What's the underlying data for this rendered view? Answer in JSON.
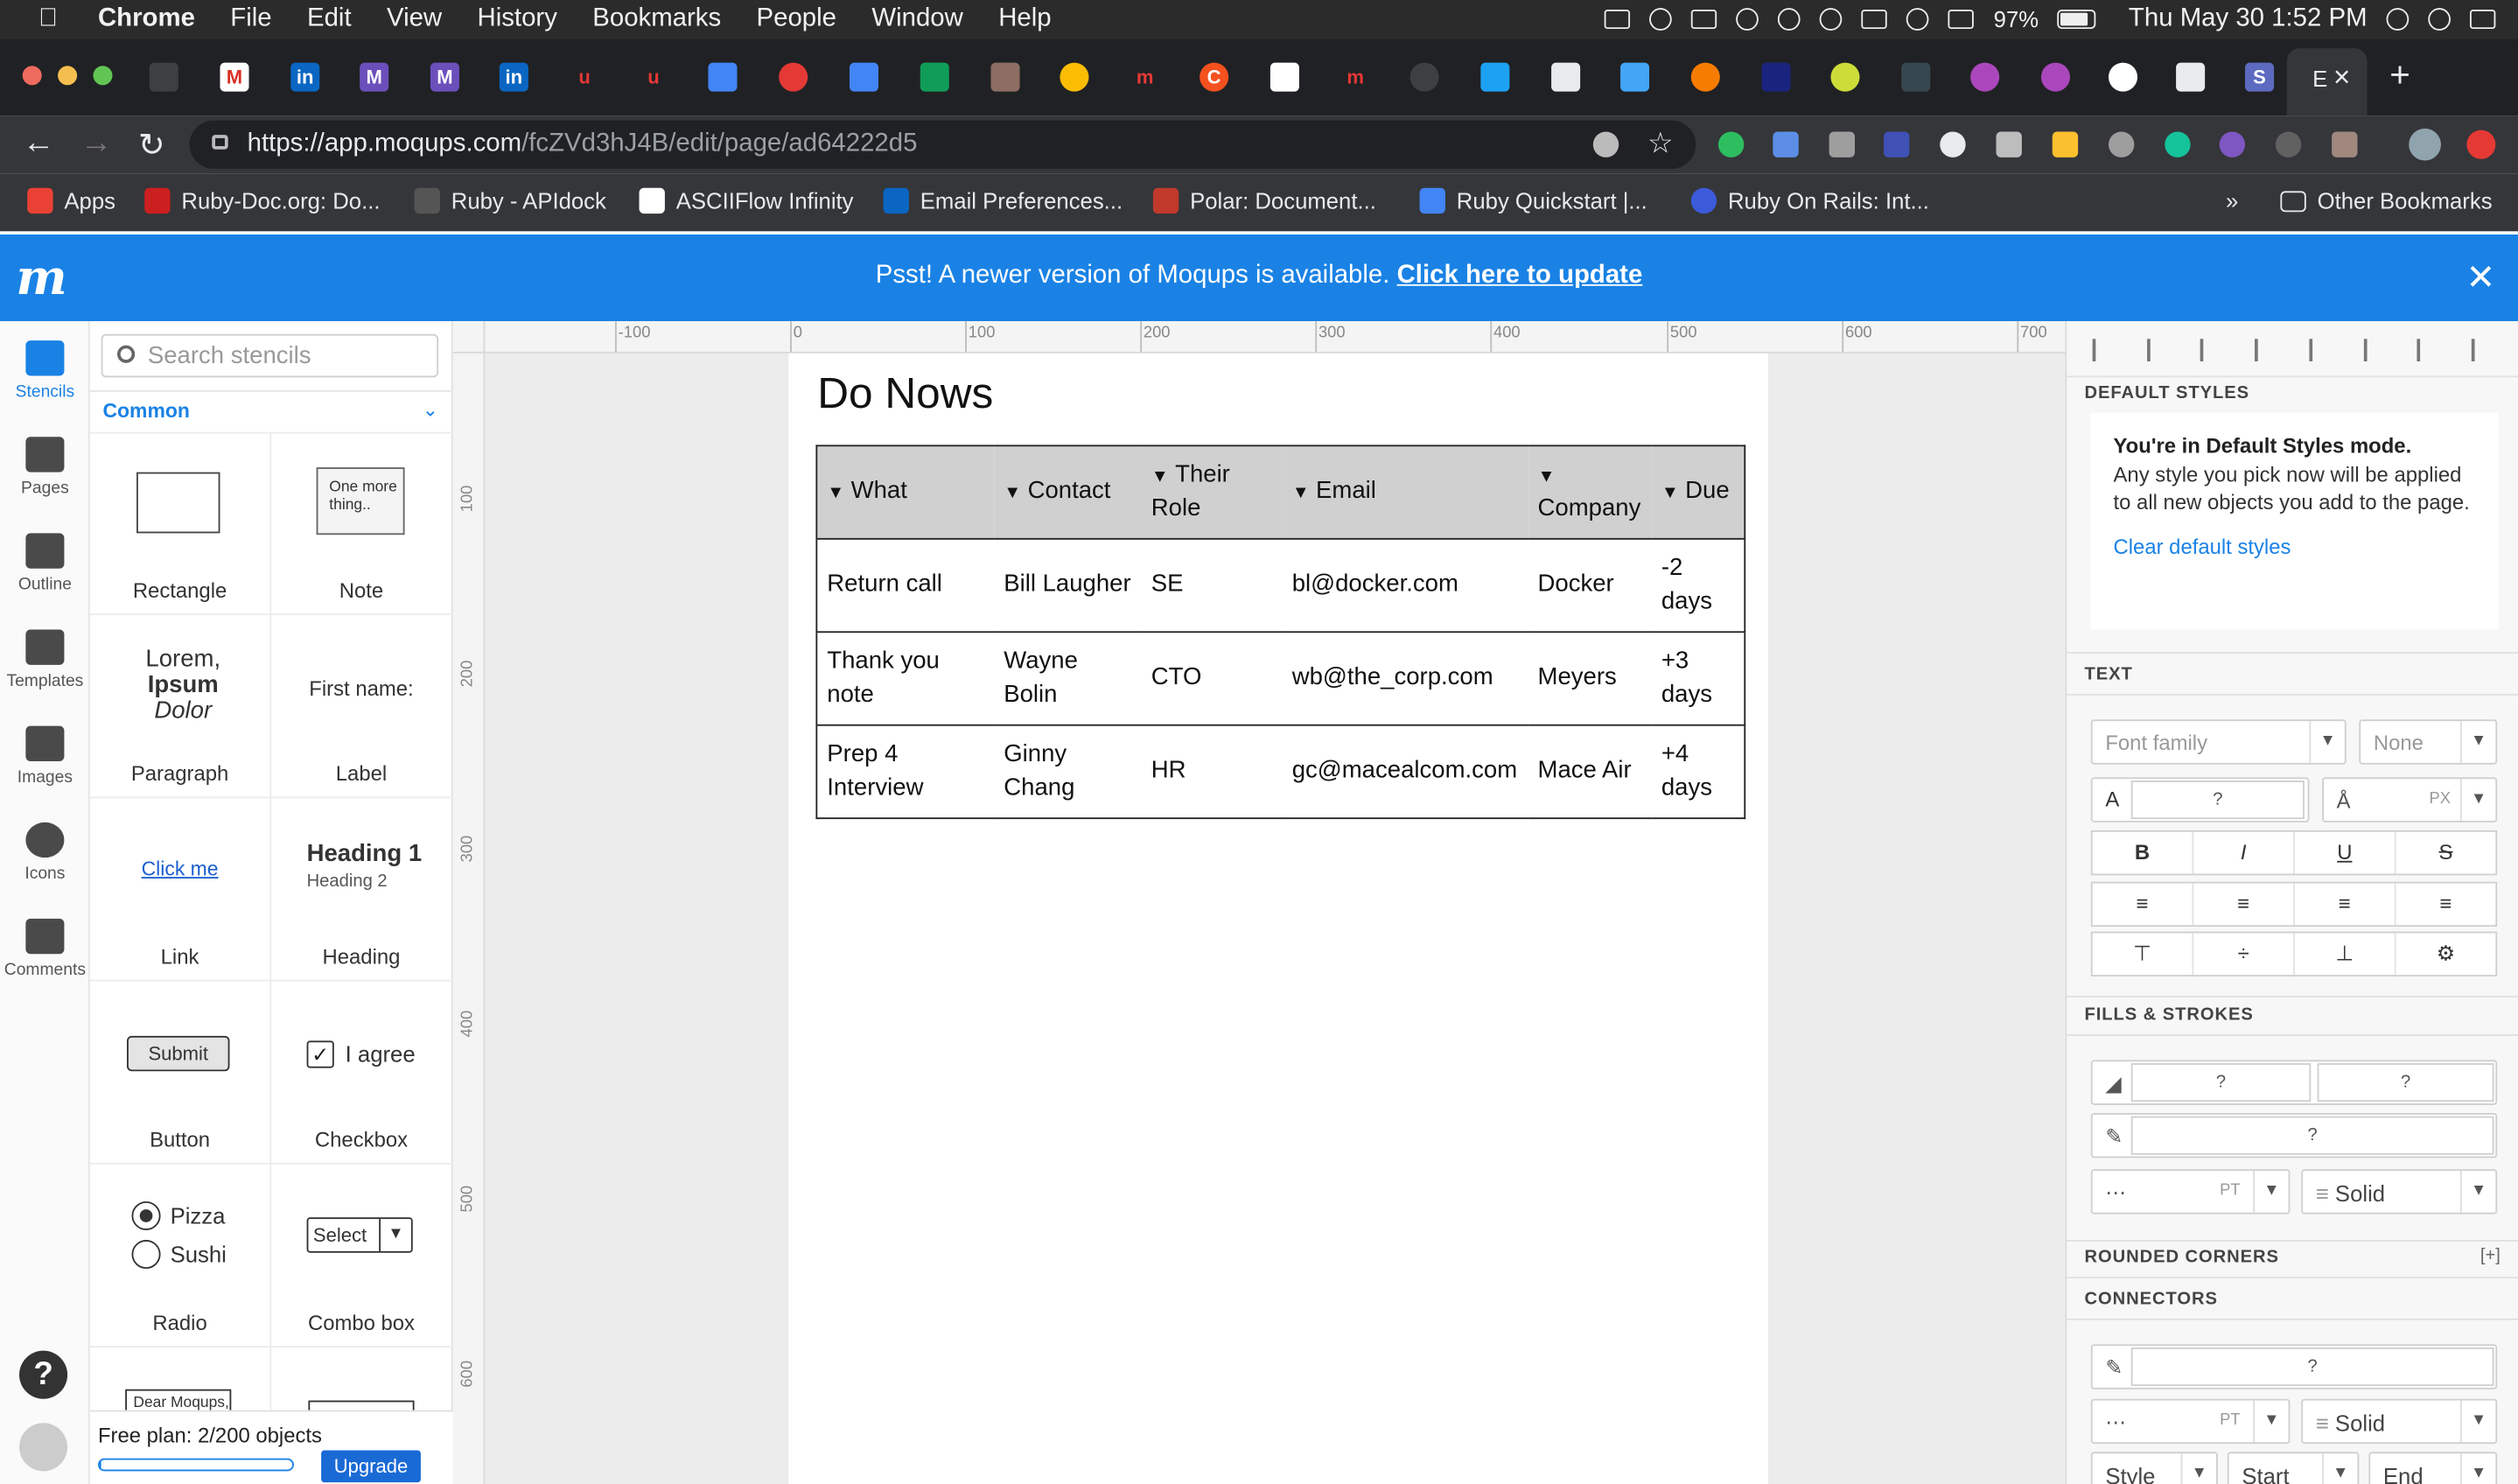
{
  "menubar": {
    "app_name": "Chrome",
    "menus": [
      "File",
      "Edit",
      "View",
      "History",
      "Bookmarks",
      "People",
      "Window",
      "Help"
    ],
    "battery": "97%",
    "clock": "Thu May 30  1:52 PM"
  },
  "browser": {
    "url_host": "https://app.moqups.com",
    "url_path": "/fcZVd3hJ4B/edit/page/ad64222d5",
    "active_tab_label": "E",
    "bookmarks": [
      {
        "label": "Apps",
        "color": "#e94235"
      },
      {
        "label": "Ruby-Doc.org: Do...",
        "color": "#cc1f1f"
      },
      {
        "label": "Ruby - APIdock",
        "color": "#555555"
      },
      {
        "label": "ASCIIFlow Infinity",
        "color": "#ffffff"
      },
      {
        "label": "Email Preferences...",
        "color": "#0a66c2"
      },
      {
        "label": "Polar: Document...",
        "color": "#c0392b"
      },
      {
        "label": "Ruby Quickstart  |...",
        "color": "#4285f4"
      },
      {
        "label": "Ruby On Rails: Int...",
        "color": "#3b5bdb"
      }
    ],
    "other_bookmarks": "Other Bookmarks"
  },
  "banner": {
    "logo": "m",
    "message": "Psst! A newer version of Moqups is available.",
    "link": "Click here to update"
  },
  "rail": {
    "items": [
      "Stencils",
      "Pages",
      "Outline",
      "Templates",
      "Images",
      "Icons",
      "Comments"
    ],
    "help": "?"
  },
  "stencils": {
    "search_placeholder": "Search stencils",
    "category": "Common",
    "items": [
      "Rectangle",
      "Note",
      "Paragraph",
      "Label",
      "Link",
      "Heading",
      "Button",
      "Checkbox",
      "Radio",
      "Combo box"
    ],
    "note_preview": "One more thing..",
    "paragraph_preview": [
      "Lorem,",
      "Ipsum",
      "Dolor"
    ],
    "label_preview": "First name:",
    "link_preview": "Click me",
    "heading_preview": [
      "Heading 1",
      "Heading 2"
    ],
    "button_preview": "Submit",
    "checkbox_preview": "I agree",
    "radio_preview": [
      "Pizza",
      "Sushi"
    ],
    "combo_preview": "Select",
    "letter_preview": "Dear Moqups,",
    "free_plan": "Free plan: 2/200 objects",
    "plan_usage_fraction": 0.01,
    "upgrade": "Upgrade"
  },
  "ruler": {
    "top": [
      "-100",
      "0",
      "100",
      "200",
      "300",
      "400",
      "500",
      "600",
      "700"
    ],
    "left": [
      "100",
      "200",
      "300",
      "400",
      "500",
      "600"
    ]
  },
  "canvas": {
    "title": "Do Nows",
    "columns": [
      "What",
      "Contact",
      "Their Role",
      "Email",
      "Company",
      "Due"
    ],
    "rows": [
      [
        "Return call",
        "Bill Laugher",
        "SE",
        "bl@docker.com",
        "Docker",
        "-2 days"
      ],
      [
        "Thank you note",
        "Wayne Bolin",
        "CTO",
        "wb@the_corp.com",
        "Meyers",
        "+3 days"
      ],
      [
        "Prep 4 Interview",
        "Ginny Chang",
        "HR",
        "gc@macealcom.com",
        "Mace Air",
        "+4 days"
      ]
    ]
  },
  "right_panel": {
    "default_styles_title": "DEFAULT STYLES",
    "default_heading": "You're in Default Styles mode.",
    "default_body": "Any style you pick now will be applied to all new objects you add to the page.",
    "clear_link": "Clear default styles",
    "text_title": "TEXT",
    "font_family": "Font family",
    "font_weight": "None",
    "color_label": "A",
    "unknown": "?",
    "px_unit": "PX",
    "pt_unit": "PT",
    "format_buttons": [
      "B",
      "I",
      "U",
      "S"
    ],
    "fills_title": "FILLS & STROKES",
    "stroke_style": "Solid",
    "rounded_title": "ROUNDED CORNERS",
    "rounded_toggle": "[+]",
    "connectors_title": "CONNECTORS",
    "connector_style": "Solid",
    "connector_fields": [
      "Style",
      "Start",
      "End"
    ]
  }
}
